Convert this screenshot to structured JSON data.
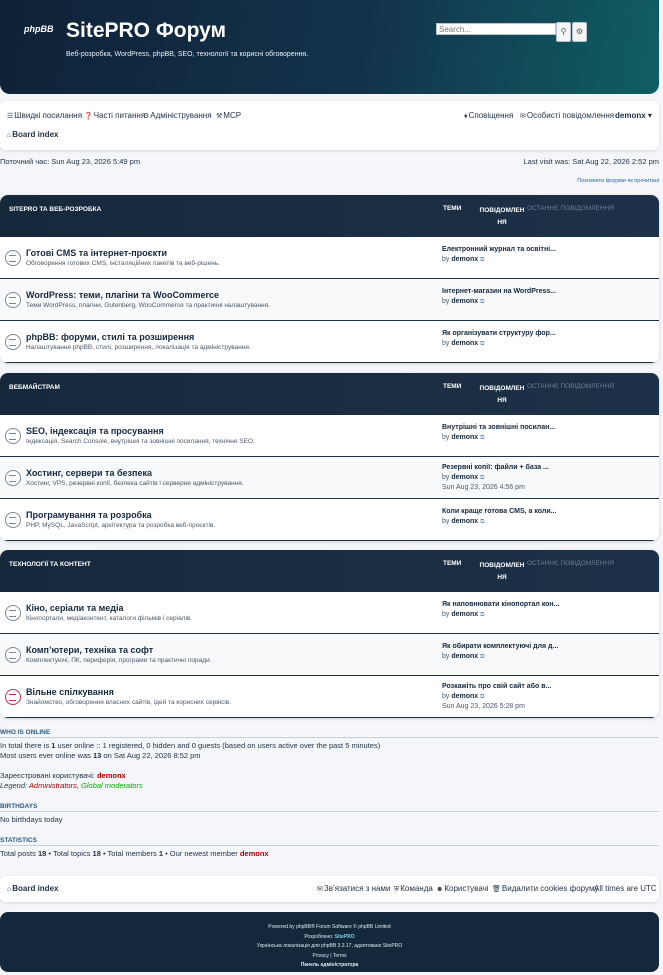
{
  "header": {
    "logo": "phpBB",
    "title": "SitePRO Форум",
    "description": "Веб-розробка, WordPress, phpBB, SEO, технології та корисні обговорення.",
    "search_placeholder": "Search...",
    "search_icon": "search-icon",
    "advanced_icon": "gear-icon"
  },
  "navbar": {
    "quick_links": "Швидкі посилання",
    "faq": "Часті питання",
    "admin": "Адміністрування",
    "mcp": "MCP",
    "notifications": "Сповіщення",
    "pm": "Особисті повідомлення",
    "username": "demonx",
    "board_index": "Board index"
  },
  "info": {
    "current_time": "Поточний час: Sun Aug 23, 2026 5:49 pm",
    "last_visit": "Last visit was: Sat Aug 22, 2026 2:52 pm",
    "mark_read": "Позначити форуми як прочитані"
  },
  "columns": {
    "topics": "ТЕМИ",
    "posts": "ПОВІДОМЛЕННЯ",
    "last_post": "ОСТАННЄ ПОВІДОМЛЕННЯ"
  },
  "categories": [
    {
      "title": "SITEPRO ТА ВЕБ-РОЗРОБКА",
      "forums": [
        {
          "name": "Готові CMS та інтернет-проєкти",
          "desc": "Обговорення готових CMS, інсталяційних пакетів та веб-рішень.",
          "last_title": "Електронний журнал та освітні...",
          "by": "by",
          "author": "demonx",
          "date": "",
          "icon_color": "#7b8794"
        },
        {
          "name": "WordPress: теми, плагіни та WooCommerce",
          "desc": "Теми WordPress, плагіни, Gutenberg, WooCommerce та практичні налаштування.",
          "last_title": "Інтернет-магазин на WordPress...",
          "by": "by",
          "author": "demonx",
          "date": "",
          "icon_color": "#7b8794"
        },
        {
          "name": "phpBB: форуми, стилі та розширення",
          "desc": "Налаштування phpBB, стилі, розширення, локалізація та адміністрування.",
          "last_title": "Як організувати структуру фор...",
          "by": "by",
          "author": "demonx",
          "date": "",
          "icon_color": "#7b8794"
        }
      ]
    },
    {
      "title": "ВЕБМАЙСТРАМ",
      "forums": [
        {
          "name": "SEO, індексація та просування",
          "desc": "Індексація, Search Console, внутрішні та зовнішні посилання, технічне SEO.",
          "last_title": "Внутрішні та зовнішні посилан...",
          "by": "by",
          "author": "demonx",
          "date": "",
          "icon_color": "#7b8794"
        },
        {
          "name": "Хостинг, сервери та безпека",
          "desc": "Хостинг, VPS, резервні копії, безпека сайтів і серверне адміністрування.",
          "last_title": "Резервні копії: файли + база ...",
          "by": "by",
          "author": "demonx",
          "date": "Sun Aug 23, 2026 4:56 pm",
          "icon_color": "#7b8794"
        },
        {
          "name": "Програмування та розробка",
          "desc": "PHP, MySQL, JavaScript, архітектура та розробка веб-проєктів.",
          "last_title": "Коли краще готова CMS, а коли...",
          "by": "by",
          "author": "demonx",
          "date": "",
          "icon_color": "#7b8794"
        }
      ]
    },
    {
      "title": "ТЕХНОЛОГІЇ ТА КОНТЕНТ",
      "forums": [
        {
          "name": "Кіно, серіали та медіа",
          "desc": "Кінопортали, медіаконтент, каталоги фільмів і серіалів.",
          "last_title": "Як наповнювати кінопортал кон...",
          "by": "by",
          "author": "demonx",
          "date": "",
          "icon_color": "#7b8794"
        },
        {
          "name": "Комп’ютери, техніка та софт",
          "desc": "Комплектуючі, ПК, периферія, програми та практичні поради.",
          "last_title": "Як обирати комплектуючі для д...",
          "by": "by",
          "author": "demonx",
          "date": "",
          "icon_color": "#7b8794"
        },
        {
          "name": "Вільне спілкування",
          "desc": "Знайомство, обговорення власних сайтів, ідей та корисних сервісів.",
          "last_title": "Розкажіть про свій сайт або в...",
          "by": "by",
          "author": "demonx",
          "date": "Sun Aug 23, 2026 5:28 pm",
          "icon_color": "#c0304a"
        }
      ]
    }
  ],
  "who_online": {
    "heading": "WHO IS ONLINE",
    "line1_pre": "In total there is ",
    "line1_count": "1",
    "line1_post": " user online :: 1 registered, 0 hidden and 0 guests (based on users active over the past 5 minutes)",
    "line2_pre": "Most users ever online was ",
    "line2_count": "13",
    "line2_post": " on Sat Aug 22, 2026 8:52 pm",
    "registered_label": "Зареєстровані користувачі: ",
    "registered_user": "demonx",
    "legend_label": "Legend: ",
    "legend_admins": "Administrators",
    "legend_sep": ", ",
    "legend_gmods": "Global moderators"
  },
  "birthdays": {
    "heading": "BIRTHDAYS",
    "text": "No birthdays today"
  },
  "statistics": {
    "heading": "STATISTICS",
    "p1": "Total posts ",
    "posts": "18",
    "p2": " • Total topics ",
    "topics": "18",
    "p3": " • Total members ",
    "members": "1",
    "p4": " • Our newest member ",
    "newest": "demonx"
  },
  "bottom_nav": {
    "board_index": "Board index",
    "contact": "Зв’язатися з нами",
    "team": "Команда",
    "members": "Користувачі",
    "delete_cookies": "Видалити cookies форуму",
    "timezone": "All times are UTC"
  },
  "footer": {
    "powered": "Powered by phpBB® Forum Software © phpBB Limited",
    "developed_label": "Розроблено: ",
    "developed_name": "SitePRO",
    "localization": "Українська локалізація для phpBB 3.3.17, адаптовано SitePRO",
    "privacy": "Privacy | Terms",
    "acp": "Панель адміністратора"
  }
}
